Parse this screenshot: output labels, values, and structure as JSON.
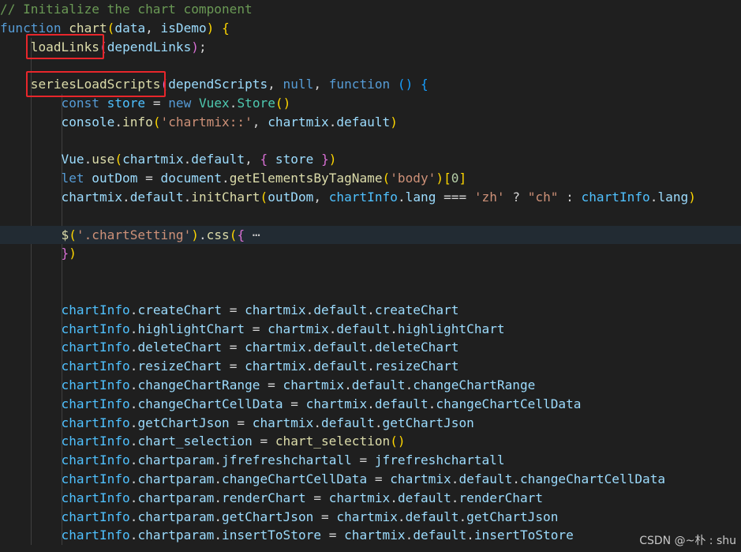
{
  "colors": {
    "background": "#1f1f1f",
    "current_line": "#222b33",
    "highlight_box": "#e8262b",
    "comment": "#6a9955",
    "keyword": "#569cd6",
    "function": "#dcdcaa",
    "variable": "#9cdcfe",
    "string": "#ce9178",
    "number": "#b5cea8",
    "class": "#4ec9b0"
  },
  "code": {
    "lines": [
      {
        "indent": 0,
        "tokens": [
          {
            "c": "comment",
            "t": "// Initialize the chart component"
          }
        ]
      },
      {
        "indent": 0,
        "tokens": [
          {
            "c": "kw",
            "t": "function"
          },
          {
            "c": "op",
            "t": " "
          },
          {
            "c": "fn",
            "t": "chart"
          },
          {
            "c": "p1",
            "t": "("
          },
          {
            "c": "var",
            "t": "data"
          },
          {
            "c": "op",
            "t": ", "
          },
          {
            "c": "var",
            "t": "isDemo"
          },
          {
            "c": "p1",
            "t": ")"
          },
          {
            "c": "op",
            "t": " "
          },
          {
            "c": "p1",
            "t": "{"
          }
        ]
      },
      {
        "indent": 4,
        "tokens": [
          {
            "c": "fn",
            "t": "loadLinks"
          },
          {
            "c": "p2",
            "t": "("
          },
          {
            "c": "var",
            "t": "dependLinks"
          },
          {
            "c": "p2",
            "t": ")"
          },
          {
            "c": "op",
            "t": ";"
          }
        ]
      },
      {
        "indent": 0,
        "tokens": []
      },
      {
        "indent": 4,
        "tokens": [
          {
            "c": "fn",
            "t": "seriesLoadScripts"
          },
          {
            "c": "p2",
            "t": "("
          },
          {
            "c": "var",
            "t": "dependScripts"
          },
          {
            "c": "op",
            "t": ", "
          },
          {
            "c": "kw",
            "t": "null"
          },
          {
            "c": "op",
            "t": ", "
          },
          {
            "c": "kw",
            "t": "function"
          },
          {
            "c": "op",
            "t": " "
          },
          {
            "c": "p3",
            "t": "()"
          },
          {
            "c": "op",
            "t": " "
          },
          {
            "c": "p3",
            "t": "{"
          }
        ]
      },
      {
        "indent": 8,
        "tokens": [
          {
            "c": "kw",
            "t": "const"
          },
          {
            "c": "op",
            "t": " "
          },
          {
            "c": "const",
            "t": "store"
          },
          {
            "c": "op",
            "t": " = "
          },
          {
            "c": "kw",
            "t": "new"
          },
          {
            "c": "op",
            "t": " "
          },
          {
            "c": "cls",
            "t": "Vuex"
          },
          {
            "c": "op",
            "t": "."
          },
          {
            "c": "cls",
            "t": "Store"
          },
          {
            "c": "p1",
            "t": "()"
          }
        ]
      },
      {
        "indent": 8,
        "tokens": [
          {
            "c": "var",
            "t": "console"
          },
          {
            "c": "op",
            "t": "."
          },
          {
            "c": "fn",
            "t": "info"
          },
          {
            "c": "p1",
            "t": "("
          },
          {
            "c": "str",
            "t": "'chartmix::'"
          },
          {
            "c": "op",
            "t": ", "
          },
          {
            "c": "var",
            "t": "chartmix"
          },
          {
            "c": "op",
            "t": "."
          },
          {
            "c": "var",
            "t": "default"
          },
          {
            "c": "p1",
            "t": ")"
          }
        ]
      },
      {
        "indent": 0,
        "tokens": []
      },
      {
        "indent": 8,
        "tokens": [
          {
            "c": "var",
            "t": "Vue"
          },
          {
            "c": "op",
            "t": "."
          },
          {
            "c": "fn",
            "t": "use"
          },
          {
            "c": "p1",
            "t": "("
          },
          {
            "c": "var",
            "t": "chartmix"
          },
          {
            "c": "op",
            "t": "."
          },
          {
            "c": "var",
            "t": "default"
          },
          {
            "c": "op",
            "t": ", "
          },
          {
            "c": "p2",
            "t": "{"
          },
          {
            "c": "op",
            "t": " "
          },
          {
            "c": "var",
            "t": "store"
          },
          {
            "c": "op",
            "t": " "
          },
          {
            "c": "p2",
            "t": "}"
          },
          {
            "c": "p1",
            "t": ")"
          }
        ]
      },
      {
        "indent": 8,
        "tokens": [
          {
            "c": "kw",
            "t": "let"
          },
          {
            "c": "op",
            "t": " "
          },
          {
            "c": "var",
            "t": "outDom"
          },
          {
            "c": "op",
            "t": " = "
          },
          {
            "c": "var",
            "t": "document"
          },
          {
            "c": "op",
            "t": "."
          },
          {
            "c": "fn",
            "t": "getElementsByTagName"
          },
          {
            "c": "p1",
            "t": "("
          },
          {
            "c": "str",
            "t": "'body'"
          },
          {
            "c": "p1",
            "t": ")"
          },
          {
            "c": "p1",
            "t": "["
          },
          {
            "c": "num",
            "t": "0"
          },
          {
            "c": "p1",
            "t": "]"
          }
        ]
      },
      {
        "indent": 8,
        "tokens": [
          {
            "c": "var",
            "t": "chartmix"
          },
          {
            "c": "op",
            "t": "."
          },
          {
            "c": "var",
            "t": "default"
          },
          {
            "c": "op",
            "t": "."
          },
          {
            "c": "fn",
            "t": "initChart"
          },
          {
            "c": "p1",
            "t": "("
          },
          {
            "c": "var",
            "t": "outDom"
          },
          {
            "c": "op",
            "t": ", "
          },
          {
            "c": "const",
            "t": "chartInfo"
          },
          {
            "c": "op",
            "t": "."
          },
          {
            "c": "var",
            "t": "lang"
          },
          {
            "c": "op",
            "t": " === "
          },
          {
            "c": "str",
            "t": "'zh'"
          },
          {
            "c": "op",
            "t": " ? "
          },
          {
            "c": "str",
            "t": "\"ch\""
          },
          {
            "c": "op",
            "t": " : "
          },
          {
            "c": "const",
            "t": "chartInfo"
          },
          {
            "c": "op",
            "t": "."
          },
          {
            "c": "var",
            "t": "lang"
          },
          {
            "c": "p1",
            "t": ")"
          }
        ]
      },
      {
        "indent": 0,
        "tokens": []
      },
      {
        "indent": 8,
        "current": true,
        "tokens": [
          {
            "c": "fn",
            "t": "$"
          },
          {
            "c": "p1",
            "t": "("
          },
          {
            "c": "str",
            "t": "'.chartSetting'"
          },
          {
            "c": "p1",
            "t": ")"
          },
          {
            "c": "op",
            "t": "."
          },
          {
            "c": "fn",
            "t": "css"
          },
          {
            "c": "p1",
            "t": "("
          },
          {
            "c": "p2",
            "t": "{"
          },
          {
            "c": "fold",
            "t": " ⋯"
          }
        ]
      },
      {
        "indent": 8,
        "tokens": [
          {
            "c": "p2",
            "t": "}"
          },
          {
            "c": "p1",
            "t": ")"
          }
        ]
      },
      {
        "indent": 0,
        "tokens": []
      },
      {
        "indent": 0,
        "tokens": []
      },
      {
        "indent": 8,
        "tokens": [
          {
            "c": "const",
            "t": "chartInfo"
          },
          {
            "c": "op",
            "t": "."
          },
          {
            "c": "var",
            "t": "createChart"
          },
          {
            "c": "op",
            "t": " = "
          },
          {
            "c": "var",
            "t": "chartmix"
          },
          {
            "c": "op",
            "t": "."
          },
          {
            "c": "var",
            "t": "default"
          },
          {
            "c": "op",
            "t": "."
          },
          {
            "c": "var",
            "t": "createChart"
          }
        ]
      },
      {
        "indent": 8,
        "tokens": [
          {
            "c": "const",
            "t": "chartInfo"
          },
          {
            "c": "op",
            "t": "."
          },
          {
            "c": "var",
            "t": "highlightChart"
          },
          {
            "c": "op",
            "t": " = "
          },
          {
            "c": "var",
            "t": "chartmix"
          },
          {
            "c": "op",
            "t": "."
          },
          {
            "c": "var",
            "t": "default"
          },
          {
            "c": "op",
            "t": "."
          },
          {
            "c": "var",
            "t": "highlightChart"
          }
        ]
      },
      {
        "indent": 8,
        "tokens": [
          {
            "c": "const",
            "t": "chartInfo"
          },
          {
            "c": "op",
            "t": "."
          },
          {
            "c": "var",
            "t": "deleteChart"
          },
          {
            "c": "op",
            "t": " = "
          },
          {
            "c": "var",
            "t": "chartmix"
          },
          {
            "c": "op",
            "t": "."
          },
          {
            "c": "var",
            "t": "default"
          },
          {
            "c": "op",
            "t": "."
          },
          {
            "c": "var",
            "t": "deleteChart"
          }
        ]
      },
      {
        "indent": 8,
        "tokens": [
          {
            "c": "const",
            "t": "chartInfo"
          },
          {
            "c": "op",
            "t": "."
          },
          {
            "c": "var",
            "t": "resizeChart"
          },
          {
            "c": "op",
            "t": " = "
          },
          {
            "c": "var",
            "t": "chartmix"
          },
          {
            "c": "op",
            "t": "."
          },
          {
            "c": "var",
            "t": "default"
          },
          {
            "c": "op",
            "t": "."
          },
          {
            "c": "var",
            "t": "resizeChart"
          }
        ]
      },
      {
        "indent": 8,
        "tokens": [
          {
            "c": "const",
            "t": "chartInfo"
          },
          {
            "c": "op",
            "t": "."
          },
          {
            "c": "var",
            "t": "changeChartRange"
          },
          {
            "c": "op",
            "t": " = "
          },
          {
            "c": "var",
            "t": "chartmix"
          },
          {
            "c": "op",
            "t": "."
          },
          {
            "c": "var",
            "t": "default"
          },
          {
            "c": "op",
            "t": "."
          },
          {
            "c": "var",
            "t": "changeChartRange"
          }
        ]
      },
      {
        "indent": 8,
        "tokens": [
          {
            "c": "const",
            "t": "chartInfo"
          },
          {
            "c": "op",
            "t": "."
          },
          {
            "c": "var",
            "t": "changeChartCellData"
          },
          {
            "c": "op",
            "t": " = "
          },
          {
            "c": "var",
            "t": "chartmix"
          },
          {
            "c": "op",
            "t": "."
          },
          {
            "c": "var",
            "t": "default"
          },
          {
            "c": "op",
            "t": "."
          },
          {
            "c": "var",
            "t": "changeChartCellData"
          }
        ]
      },
      {
        "indent": 8,
        "tokens": [
          {
            "c": "const",
            "t": "chartInfo"
          },
          {
            "c": "op",
            "t": "."
          },
          {
            "c": "var",
            "t": "getChartJson"
          },
          {
            "c": "op",
            "t": " = "
          },
          {
            "c": "var",
            "t": "chartmix"
          },
          {
            "c": "op",
            "t": "."
          },
          {
            "c": "var",
            "t": "default"
          },
          {
            "c": "op",
            "t": "."
          },
          {
            "c": "var",
            "t": "getChartJson"
          }
        ]
      },
      {
        "indent": 8,
        "tokens": [
          {
            "c": "const",
            "t": "chartInfo"
          },
          {
            "c": "op",
            "t": "."
          },
          {
            "c": "var",
            "t": "chart_selection"
          },
          {
            "c": "op",
            "t": " = "
          },
          {
            "c": "fn",
            "t": "chart_selection"
          },
          {
            "c": "p1",
            "t": "()"
          }
        ]
      },
      {
        "indent": 8,
        "tokens": [
          {
            "c": "const",
            "t": "chartInfo"
          },
          {
            "c": "op",
            "t": "."
          },
          {
            "c": "var",
            "t": "chartparam"
          },
          {
            "c": "op",
            "t": "."
          },
          {
            "c": "var",
            "t": "jfrefreshchartall"
          },
          {
            "c": "op",
            "t": " = "
          },
          {
            "c": "var",
            "t": "jfrefreshchartall"
          }
        ]
      },
      {
        "indent": 8,
        "tokens": [
          {
            "c": "const",
            "t": "chartInfo"
          },
          {
            "c": "op",
            "t": "."
          },
          {
            "c": "var",
            "t": "chartparam"
          },
          {
            "c": "op",
            "t": "."
          },
          {
            "c": "var",
            "t": "changeChartCellData"
          },
          {
            "c": "op",
            "t": " = "
          },
          {
            "c": "var",
            "t": "chartmix"
          },
          {
            "c": "op",
            "t": "."
          },
          {
            "c": "var",
            "t": "default"
          },
          {
            "c": "op",
            "t": "."
          },
          {
            "c": "var",
            "t": "changeChartCellData"
          }
        ]
      },
      {
        "indent": 8,
        "tokens": [
          {
            "c": "const",
            "t": "chartInfo"
          },
          {
            "c": "op",
            "t": "."
          },
          {
            "c": "var",
            "t": "chartparam"
          },
          {
            "c": "op",
            "t": "."
          },
          {
            "c": "var",
            "t": "renderChart"
          },
          {
            "c": "op",
            "t": " = "
          },
          {
            "c": "var",
            "t": "chartmix"
          },
          {
            "c": "op",
            "t": "."
          },
          {
            "c": "var",
            "t": "default"
          },
          {
            "c": "op",
            "t": "."
          },
          {
            "c": "var",
            "t": "renderChart"
          }
        ]
      },
      {
        "indent": 8,
        "tokens": [
          {
            "c": "const",
            "t": "chartInfo"
          },
          {
            "c": "op",
            "t": "."
          },
          {
            "c": "var",
            "t": "chartparam"
          },
          {
            "c": "op",
            "t": "."
          },
          {
            "c": "var",
            "t": "getChartJson"
          },
          {
            "c": "op",
            "t": " = "
          },
          {
            "c": "var",
            "t": "chartmix"
          },
          {
            "c": "op",
            "t": "."
          },
          {
            "c": "var",
            "t": "default"
          },
          {
            "c": "op",
            "t": "."
          },
          {
            "c": "var",
            "t": "getChartJson"
          }
        ]
      },
      {
        "indent": 8,
        "tokens": [
          {
            "c": "const",
            "t": "chartInfo"
          },
          {
            "c": "op",
            "t": "."
          },
          {
            "c": "var",
            "t": "chartparam"
          },
          {
            "c": "op",
            "t": "."
          },
          {
            "c": "var",
            "t": "insertToStore"
          },
          {
            "c": "op",
            "t": " = "
          },
          {
            "c": "var",
            "t": "chartmix"
          },
          {
            "c": "op",
            "t": "."
          },
          {
            "c": "var",
            "t": "default"
          },
          {
            "c": "op",
            "t": "."
          },
          {
            "c": "var",
            "t": "insertToStore"
          }
        ]
      }
    ]
  },
  "highlights": [
    {
      "label": "loadLinks",
      "line_index": 2
    },
    {
      "label": "seriesLoadScripts",
      "line_index": 4
    }
  ],
  "watermark": "CSDN @~朴 : shu"
}
